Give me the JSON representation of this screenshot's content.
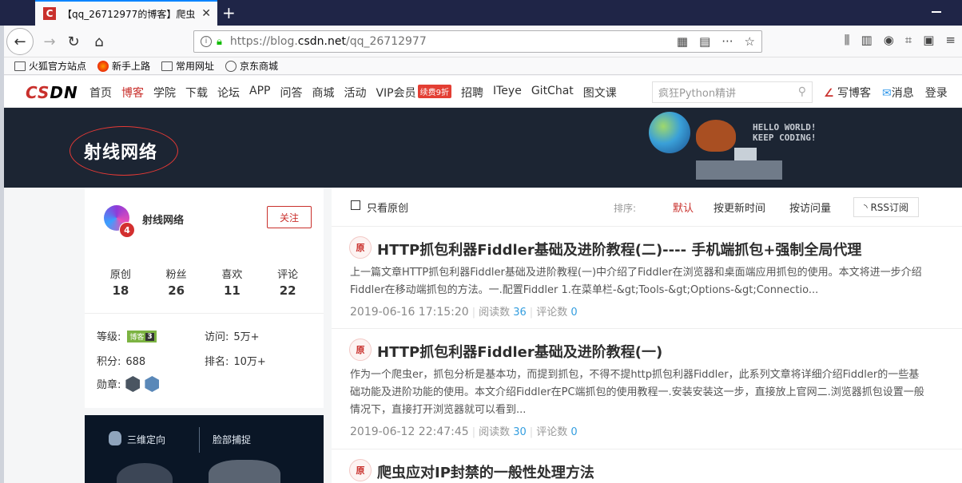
{
  "browser": {
    "tab_title": "【qq_26712977的博客】爬虫",
    "tab_favicon": "C",
    "url_prefix": "https://blog.",
    "url_domain": "csdn.net",
    "url_path": "/qq_26712977"
  },
  "bookmarks": [
    {
      "label": "火狐官方站点",
      "icon": "folder-icon"
    },
    {
      "label": "新手上路",
      "icon": "firefox-icon"
    },
    {
      "label": "常用网址",
      "icon": "folder-icon"
    },
    {
      "label": "京东商城",
      "icon": "globe-icon"
    }
  ],
  "csdn": {
    "logo_c": "CS",
    "logo_rest": "DN",
    "nav": [
      "首页",
      "博客",
      "学院",
      "下载",
      "论坛",
      "APP",
      "问答",
      "商城",
      "活动",
      "VIP会员",
      "招聘",
      "ITeye",
      "GitChat",
      "图文课"
    ],
    "vip_badge": "续费9折",
    "search_placeholder": "疯狂Python精讲",
    "write": "写博客",
    "message": "消息",
    "login": "登录"
  },
  "banner": {
    "blog_name": "射线网络",
    "hello1": "HELLO WORLD!",
    "hello2": "KEEP CODING!"
  },
  "profile": {
    "name": "射线网络",
    "avatar_badge": "4",
    "follow": "关注",
    "stats": [
      {
        "label": "原创",
        "value": "18"
      },
      {
        "label": "粉丝",
        "value": "26"
      },
      {
        "label": "喜欢",
        "value": "11"
      },
      {
        "label": "评论",
        "value": "22"
      }
    ],
    "level_label": "等级:",
    "level_badge": "博客",
    "level_num": "3",
    "visit_label": "访问:",
    "visit_value": "5万+",
    "points_label": "积分:",
    "points_value": "688",
    "rank_label": "排名:",
    "rank_value": "10万+",
    "medal_label": "勋章:"
  },
  "ad": {
    "label1": "三维定向",
    "label2": "脸部捕捉"
  },
  "filter": {
    "only_original": "只看原创",
    "sort_label": "排序:",
    "sort_default": "默认",
    "sort_time": "按更新时间",
    "sort_visit": "按访问量",
    "rss": "RSS订阅"
  },
  "articles": [
    {
      "badge": "原",
      "title": "HTTP抓包利器Fiddler基础及进阶教程(二)---- 手机端抓包+强制全局代理",
      "desc": "上一篇文章HTTP抓包利器Fiddler基础及进阶教程(一)中介绍了Fiddler在浏览器和桌面端应用抓包的使用。本文将进一步介绍Fiddler在移动端抓包的方法。一.配置Fiddler 1.在菜单栏-&gt;Tools-&gt;Options-&gt;Connectio...",
      "date": "2019-06-16 17:15:20",
      "read_label": "阅读数",
      "read": "36",
      "comment_label": "评论数",
      "comment": "0"
    },
    {
      "badge": "原",
      "title": "HTTP抓包利器Fiddler基础及进阶教程(一)",
      "desc": "作为一个爬虫er，抓包分析是基本功，而提到抓包，不得不提http抓包利器Fiddler，此系列文章将详细介绍Fiddler的一些基础功能及进阶功能的使用。本文介绍Fiddler在PC端抓包的使用教程一.安装安装这一步，直接放上官网二.浏览器抓包设置一般情况下，直接打开浏览器就可以看到...",
      "date": "2019-06-12 22:47:45",
      "read_label": "阅读数",
      "read": "30",
      "comment_label": "评论数",
      "comment": "0"
    },
    {
      "badge": "原",
      "title": "爬虫应对IP封禁的一般性处理方法"
    }
  ]
}
